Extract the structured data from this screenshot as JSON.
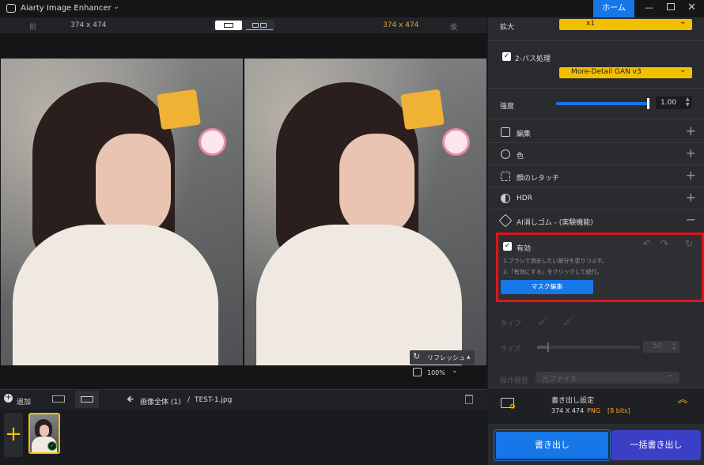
{
  "app": {
    "title": "Aiarty Image Enhancer",
    "home": "ホーム"
  },
  "viewer": {
    "before_label": "前",
    "after_label": "後",
    "before_size": "374 x 474",
    "after_size": "374 x 474",
    "refresh": "リフレッシュ",
    "zoom": "100%"
  },
  "toolbar": {
    "add": "追加",
    "breadcrumb_root": "画像全体 (1)",
    "breadcrumb_sep": "/",
    "filename": "TEST-1.jpg"
  },
  "sidebar": {
    "scale_label": "拡大",
    "scale_value": "x1",
    "twopass_label": "2-パス処理",
    "model_value": "More-Detail GAN  v3",
    "strength_label": "強度",
    "strength_value": "1.00",
    "strength_fraction": 0.98,
    "sections": [
      {
        "label": "編集",
        "icon": "edit-icon"
      },
      {
        "label": "色",
        "icon": "palette-icon"
      },
      {
        "label": "顔のレタッチ",
        "icon": "face-icon"
      },
      {
        "label": "HDR",
        "icon": "hdr-icon"
      }
    ],
    "eraser_label": "AI消しゴム - (実験機能)",
    "enable_label": "有効",
    "instruction1": "1.ブラシで消去したい部分を塗りつぶす。",
    "instruction2": "2.「有効にする」をクリックして続行。",
    "mask_button": "マスク編集",
    "type_label": "タイプ",
    "size_label": "サイズ",
    "size_value": "50",
    "history_label": "操作履歴",
    "history_value": "元ファイル",
    "export_title": "書き出し設定",
    "export_dims": "374 X 474",
    "export_format": "PNG",
    "export_bits": "[8 bits]",
    "export_button": "書き出し",
    "batch_export_button": "一括書き出し"
  },
  "colors": {
    "accent_blue": "#1677e8",
    "highlight_red": "#e0131b",
    "select_yellow": "#f3c000",
    "orange": "#f0a030"
  }
}
